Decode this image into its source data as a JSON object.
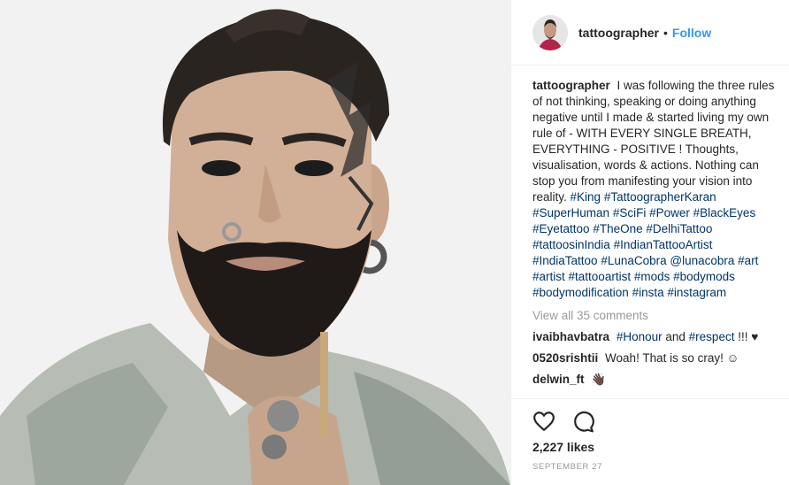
{
  "post": {
    "username": "tattoographer",
    "separator": "•",
    "follow_label": "Follow"
  },
  "caption": {
    "username": "tattoographer",
    "text": "I was following the three rules of not thinking, speaking or doing anything negative until I made & started living my own rule of - WITH EVERY SINGLE BREATH, EVERYTHING - POSITIVE ! Thoughts, visualisation, words & actions. Nothing can stop you from manifesting your vision into reality.",
    "hashtags": [
      "#King",
      "#TattoographerKaran",
      "#SuperHuman",
      "#SciFi",
      "#Power",
      "#BlackEyes",
      "#Eyetattoo",
      "#TheOne",
      "#DelhiTattoo",
      "#tattoosinIndia",
      "#IndianTattooArtist",
      "#IndiaTattoo",
      "#LunaCobra",
      "@lunacobra",
      "#art",
      "#artist",
      "#tattooartist",
      "#mods",
      "#bodymods",
      "#bodymodification",
      "#insta",
      "#instagram"
    ]
  },
  "view_all_comments": "View all 35 comments",
  "comments": [
    {
      "username": "ivaibhavbatra",
      "tags": [
        "#Honour",
        "and",
        "#respect"
      ],
      "suffix": "!!! ♥"
    },
    {
      "username": "0520srishtii",
      "text": "Woah! That is so cray! ☺"
    },
    {
      "username": "delwin_ft",
      "text": "👋🏿"
    }
  ],
  "likes": "2,227 likes",
  "date": "SEPTEMBER 27",
  "icons": {
    "like": "heart-icon",
    "comment": "comment-icon"
  }
}
